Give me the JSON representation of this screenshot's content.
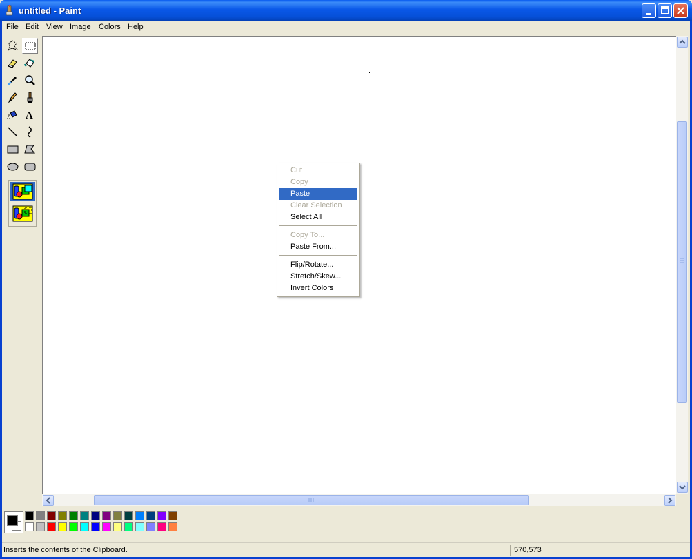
{
  "window": {
    "title": "untitled - Paint"
  },
  "menubar": {
    "items": [
      "File",
      "Edit",
      "View",
      "Image",
      "Colors",
      "Help"
    ]
  },
  "toolbox": {
    "tools": [
      {
        "name": "free-form-select-icon"
      },
      {
        "name": "select-icon",
        "selected": true
      },
      {
        "name": "eraser-icon"
      },
      {
        "name": "fill-bucket-icon"
      },
      {
        "name": "pick-color-icon"
      },
      {
        "name": "magnifier-icon"
      },
      {
        "name": "pencil-icon"
      },
      {
        "name": "brush-icon"
      },
      {
        "name": "airbrush-icon"
      },
      {
        "name": "text-icon",
        "label": "A"
      },
      {
        "name": "line-icon"
      },
      {
        "name": "curve-icon"
      },
      {
        "name": "rectangle-icon"
      },
      {
        "name": "polygon-icon"
      },
      {
        "name": "ellipse-icon"
      },
      {
        "name": "rounded-rectangle-icon"
      }
    ],
    "options": [
      "opaque-selection-icon",
      "transparent-selection-icon"
    ]
  },
  "context_menu": {
    "items": [
      {
        "label": "Cut",
        "enabled": false
      },
      {
        "label": "Copy",
        "enabled": false
      },
      {
        "label": "Paste",
        "enabled": true,
        "highlighted": true
      },
      {
        "label": "Clear Selection",
        "enabled": false
      },
      {
        "label": "Select All",
        "enabled": true
      },
      {
        "label": "Copy To...",
        "enabled": false
      },
      {
        "label": "Paste From...",
        "enabled": true
      },
      {
        "label": "Flip/Rotate...",
        "enabled": true
      },
      {
        "label": "Stretch/Skew...",
        "enabled": true
      },
      {
        "label": "Invert Colors",
        "enabled": true
      }
    ]
  },
  "palette": {
    "foreground": "#000000",
    "background": "#ffffff",
    "row1": [
      "#000000",
      "#808080",
      "#800000",
      "#808000",
      "#008000",
      "#008080",
      "#000080",
      "#800080",
      "#808040",
      "#004040",
      "#0080ff",
      "#004080",
      "#8000ff",
      "#804000"
    ],
    "row2": [
      "#ffffff",
      "#c0c0c0",
      "#ff0000",
      "#ffff00",
      "#00ff00",
      "#00ffff",
      "#0000ff",
      "#ff00ff",
      "#ffff80",
      "#00ff80",
      "#80ffff",
      "#8080ff",
      "#ff0080",
      "#ff8040"
    ]
  },
  "statusbar": {
    "text": "Inserts the contents of the Clipboard.",
    "coords": "570,573"
  }
}
